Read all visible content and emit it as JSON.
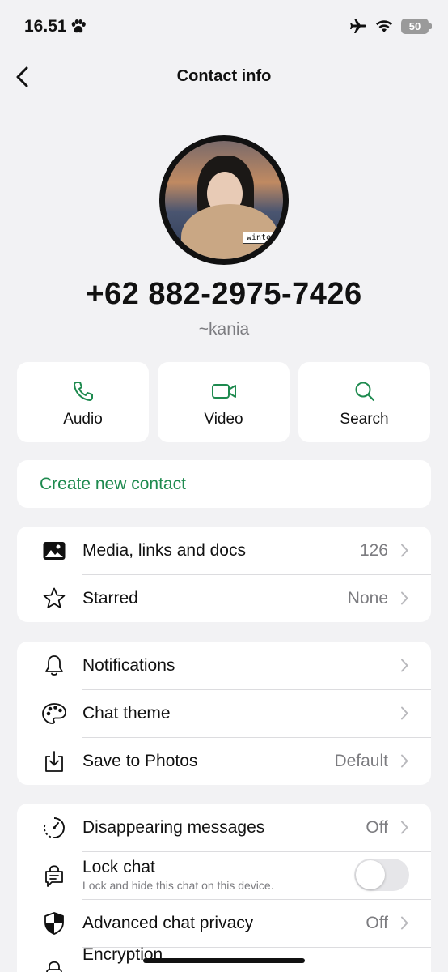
{
  "status": {
    "time": "16.51",
    "battery": "50"
  },
  "header": {
    "title": "Contact info"
  },
  "profile": {
    "avatar_tag": "winter",
    "phone": "+62 882-2975-7426",
    "nickname": "~kania"
  },
  "actions": [
    {
      "label": "Audio",
      "icon": "phone-icon"
    },
    {
      "label": "Video",
      "icon": "video-icon"
    },
    {
      "label": "Search",
      "icon": "search-icon"
    }
  ],
  "create_contact": {
    "label": "Create new contact"
  },
  "media_group": [
    {
      "label": "Media, links and docs",
      "value": "126",
      "icon": "image-icon"
    },
    {
      "label": "Starred",
      "value": "None",
      "icon": "star-icon"
    }
  ],
  "settings_group": [
    {
      "label": "Notifications",
      "value": "",
      "icon": "bell-icon"
    },
    {
      "label": "Chat theme",
      "value": "",
      "icon": "palette-icon"
    },
    {
      "label": "Save to Photos",
      "value": "Default",
      "icon": "download-icon"
    }
  ],
  "privacy_group": {
    "disappearing": {
      "label": "Disappearing messages",
      "value": "Off"
    },
    "lock": {
      "label": "Lock chat",
      "sublabel": "Lock and hide this chat on this device.",
      "enabled": false
    },
    "advanced": {
      "label": "Advanced chat privacy",
      "value": "Off"
    },
    "encryption": {
      "label": "Encryption"
    }
  },
  "colors": {
    "accent": "#1e8a4f",
    "background": "#f2f2f4"
  }
}
